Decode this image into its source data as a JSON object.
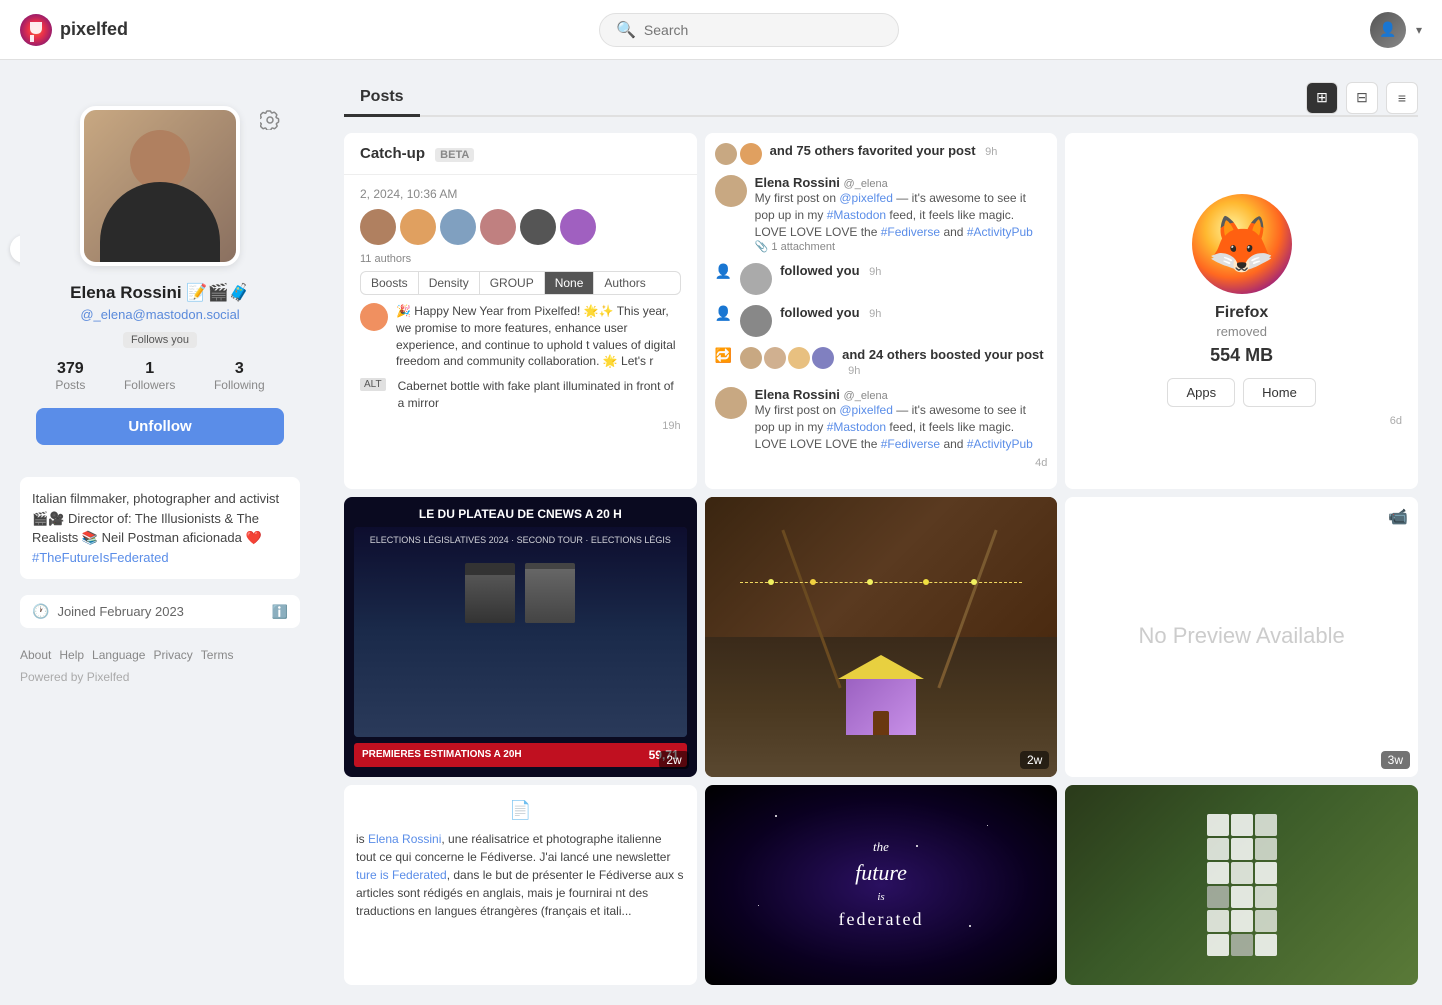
{
  "app": {
    "name": "pixelfed",
    "logo_alt": "Pixelfed logo"
  },
  "topnav": {
    "search_placeholder": "Search",
    "dropdown_arrow": "▾"
  },
  "sidebar": {
    "profile": {
      "name": "Elena Rossini 📝🎬🧳",
      "handle": "@_elena@mastodon.social",
      "follows_you": "Follows you",
      "stats": {
        "posts": {
          "value": "379",
          "label": "Posts"
        },
        "followers": {
          "value": "1",
          "label": "Followers"
        },
        "following": {
          "value": "3",
          "label": "Following"
        }
      },
      "unfollow_btn": "Unfollow",
      "bio": "Italian filmmaker, photographer and activist 🎬🎥 Director of: The Illusionists & The Realists 📚 Neil Postman aficionada ❤️ #TheFutureIsFederated",
      "bio_hashtag": "#TheFutureIsFederated",
      "joined": "Joined February 2023"
    },
    "footer": {
      "about": "About",
      "help": "Help",
      "language": "Language",
      "privacy": "Privacy",
      "terms": "Terms",
      "powered_by": "Powered by Pixelfed"
    }
  },
  "main": {
    "tabs": [
      {
        "label": "Posts",
        "active": true
      }
    ],
    "view_modes": [
      "grid-large",
      "grid-small",
      "list"
    ],
    "posts": {
      "catchup": {
        "title": "Catch-up",
        "beta": "BETA",
        "time": "2, 2024, 10:36 AM",
        "authors_count": "11 authors",
        "tabs": [
          "Boosts",
          "Density",
          "GROUP",
          "None",
          "Authors"
        ],
        "active_tab": "None",
        "new_year_text": "🎉 Happy New Year from Pixelfed! 🌟✨ This year, we promise to more features, enhance user experience, and continue to uphold t values of digital freedom and community collaboration. 🌟 Let's r",
        "alt_text": "Cabernet bottle with fake plant illuminated in front of a mirror",
        "time_ago": "19h"
      },
      "notification_card": {
        "items": [
          {
            "type": "favorited",
            "text": "and 75 others favorited your post",
            "time": "9h"
          },
          {
            "type": "post",
            "name": "Elena Rossini",
            "handles": [
              "@pixelfed",
              "@_elena"
            ],
            "text": "My first post on @pixelfed — it's awesome to see it pop up in my #Mastodon feed, it feels like magic.",
            "hashtags": [
              "#Fediverse",
              "#ActivityPub"
            ],
            "love_text": "LOVE LOVE LOVE the #Fediverse and #ActivityPub",
            "attachment": "1 attachment"
          },
          {
            "type": "followed",
            "text": "followed you",
            "time": "9h"
          },
          {
            "type": "followed",
            "text": "followed you",
            "time": "9h"
          },
          {
            "type": "boosted",
            "text": "and 24 others boosted your post",
            "time": "9h"
          },
          {
            "type": "post2",
            "name": "Elena Rossini",
            "handles": [
              "@pixelfed",
              "@_elena"
            ],
            "text": "My first post on @pixelfed — it's awesome to see it pop up in my #Mastodon feed, it feels like magic.",
            "love_text": "LOVE LOVE LOVE the #Fediverse and #ActivityPub",
            "age": "4d"
          }
        ]
      },
      "firefox_card": {
        "name": "Firefox",
        "status": "removed",
        "size": "554 MB",
        "btn_apps": "Apps",
        "btn_home": "Home",
        "age": "6d"
      },
      "elections_card": {
        "title": "LE DU PLATEAU DE CNEWS A 20 H",
        "subtitle": "PREMIERES ESTIMATIONS A 20H",
        "bar_value": "59,71",
        "age": "2w"
      },
      "room_card": {
        "age": "2w"
      },
      "no_preview_card": {
        "text": "No Preview Available",
        "age": "3w"
      },
      "text_post_card": {
        "text_preview": "Elena Rossini, une réalisatrice et photographe italienne tout ce qui concerne le Fédiverse. J'ai lancé une newsletter ture is Federated, dans le but de présenter le Fédiverse aux s articles sont rédigés en anglais, mais je fournirai nt des traductions en langues étrangères (français et itali..."
      },
      "future_card": {
        "line1": "the",
        "line2": "future",
        "line3": "is",
        "line4": "federated"
      },
      "lego_card": {}
    }
  }
}
